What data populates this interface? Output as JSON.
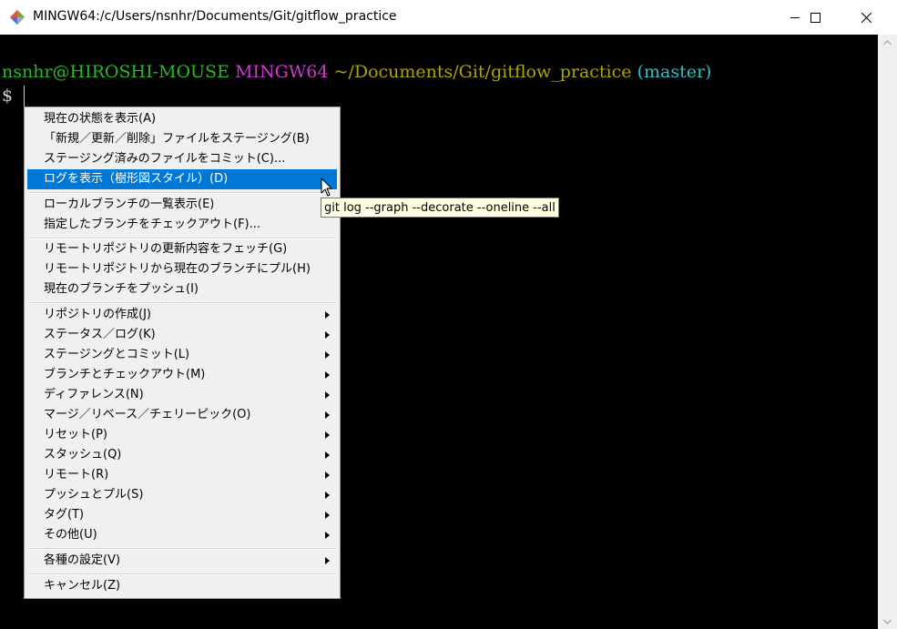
{
  "window": {
    "title": "MINGW64:/c/Users/nsnhr/Documents/Git/gitflow_practice",
    "icons": {
      "app": "git-bash-icon",
      "minimize": "minimize-icon",
      "maximize": "maximize-icon",
      "close": "close-icon"
    }
  },
  "terminal": {
    "user_host": "nsnhr@HIROSHI-MOUSE",
    "system": "MINGW64",
    "path": "~/Documents/Git/gitflow_practice",
    "branch": "(master)",
    "prompt": "$"
  },
  "menu": {
    "items": [
      "現在の状態を表示(A)",
      "「新規／更新／削除」ファイルをステージング(B)",
      "ステージング済みのファイルをコミット(C)...",
      "ログを表示（樹形図スタイル）(D)",
      "ローカルブランチの一覧表示(E)",
      "指定したブランチをチェックアウト(F)...",
      "リモートリポジトリの更新内容をフェッチ(G)",
      "リモートリポジトリから現在のブランチにプル(H)",
      "現在のブランチをプッシュ(I)",
      "リポジトリの作成(J)",
      "ステータス／ログ(K)",
      "ステージングとコミット(L)",
      "ブランチとチェックアウト(M)",
      "ディファレンス(N)",
      "マージ／リベース／チェリーピック(O)",
      "リセット(P)",
      "スタッシュ(Q)",
      "リモート(R)",
      "プッシュとプル(S)",
      "タグ(T)",
      "その他(U)",
      "各種の設定(V)",
      "キャンセル(Z)"
    ],
    "highlighted_index": 3
  },
  "tooltip": {
    "text": "git log --graph --decorate --oneline --all"
  },
  "colors": {
    "user": "#25bc24",
    "host": "#d338d3",
    "path": "#ada600",
    "branch": "#33bbc8",
    "highlight": "#0078d7"
  }
}
